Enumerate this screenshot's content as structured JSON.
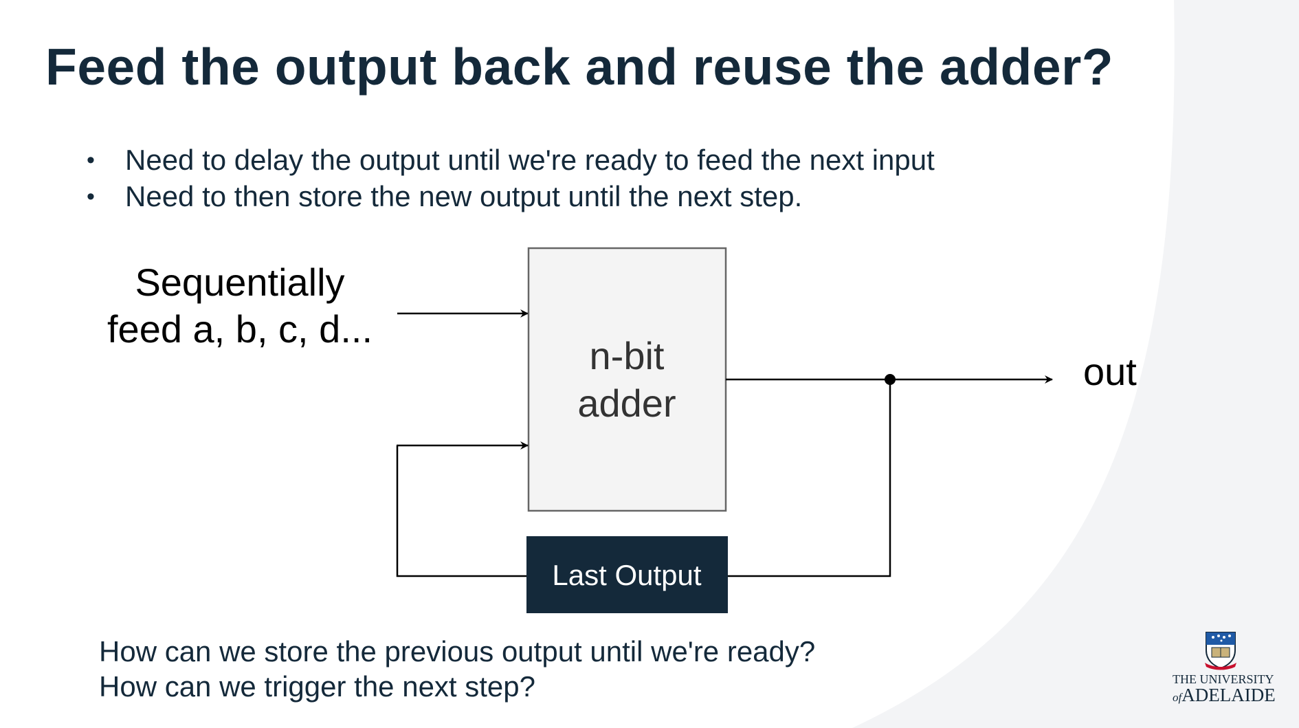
{
  "slide": {
    "title": "Feed the output back and reuse the adder?",
    "bullets": [
      "Need to delay the output until we're ready to feed the next input",
      "Need to then store the new output until the next step."
    ],
    "questions": [
      "How can we store the previous output until we're ready?",
      "How can we trigger the next step?"
    ]
  },
  "diagram": {
    "input_label_line1": "Sequentially",
    "input_label_line2": "feed a, b, c, d...",
    "adder_label_line1": "n-bit",
    "adder_label_line2": "adder",
    "register_label": "Last Output",
    "output_label": "out"
  },
  "logo": {
    "line1": "THE UNIVERSITY",
    "of": "of",
    "line2": "ADELAIDE"
  },
  "colors": {
    "navy": "#14293a",
    "adder_fill": "#f4f4f4",
    "background_curve": "#f3f4f6"
  }
}
